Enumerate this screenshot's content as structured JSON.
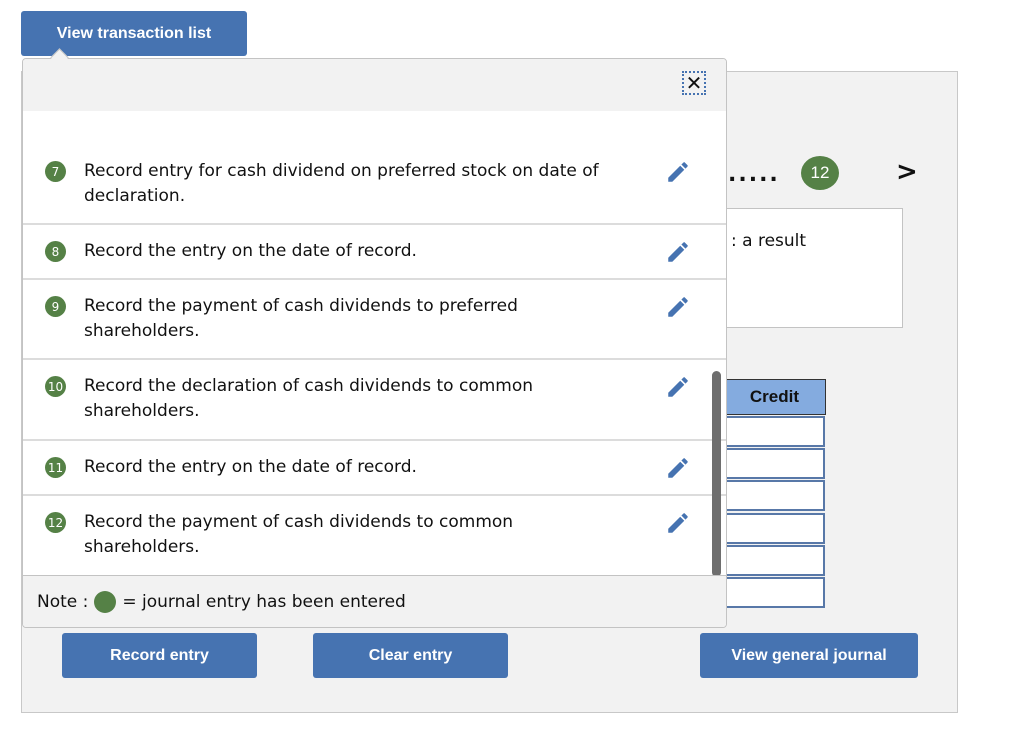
{
  "header": {
    "view_list_label": "View transaction list"
  },
  "navigator": {
    "dots": ".....",
    "current": "12",
    "next_icon": "chevron-right"
  },
  "question_box": {
    "text": ": a result"
  },
  "journal": {
    "credit_header": "Credit",
    "credit_rows": 6
  },
  "popup": {
    "close_icon": "✕",
    "items": [
      {
        "num": "7",
        "text": "Record entry for cash dividend on preferred stock on date of declaration.",
        "entered": true
      },
      {
        "num": "8",
        "text": "Record the entry on the date of record.",
        "entered": true
      },
      {
        "num": "9",
        "text": "Record the payment of cash dividends to preferred shareholders.",
        "entered": true
      },
      {
        "num": "10",
        "text": "Record the declaration of cash dividends to common shareholders.",
        "entered": true
      },
      {
        "num": "11",
        "text": "Record the entry on the date of record.",
        "entered": true
      },
      {
        "num": "12",
        "text": "Record the payment of cash dividends to common shareholders.",
        "entered": true
      }
    ],
    "note_prefix": "Note :",
    "note_suffix": "= journal entry has been entered"
  },
  "buttons": {
    "record_entry": "Record entry",
    "clear_entry": "Clear entry",
    "view_general_journal": "View general journal"
  },
  "colors": {
    "accent": "#4673b1",
    "entered_green": "#558146",
    "credit_header": "#84abdf"
  }
}
